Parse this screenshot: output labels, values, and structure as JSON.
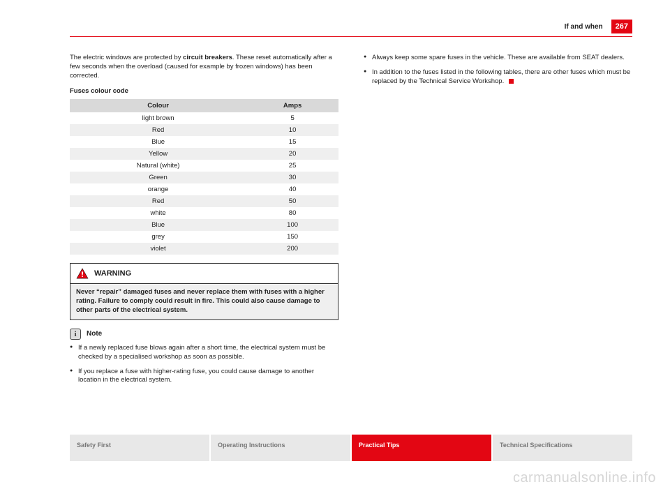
{
  "header": {
    "section": "If and when",
    "page": "267"
  },
  "col1": {
    "intro": "The electric windows are protected by circuit breakers. These reset automatically after a few seconds when the overload (caused for example by frozen windows) has been corrected.",
    "intro_bold": "circuit breakers",
    "table_title": "Fuses colour code",
    "table": {
      "headers": [
        "Colour",
        "Amps"
      ],
      "rows": [
        [
          "light brown",
          "5"
        ],
        [
          "Red",
          "10"
        ],
        [
          "Blue",
          "15"
        ],
        [
          "Yellow",
          "20"
        ],
        [
          "Natural (white)",
          "25"
        ],
        [
          "Green",
          "30"
        ],
        [
          "orange",
          "40"
        ],
        [
          "Red",
          "50"
        ],
        [
          "white",
          "80"
        ],
        [
          "Blue",
          "100"
        ],
        [
          "grey",
          "150"
        ],
        [
          "violet",
          "200"
        ]
      ]
    },
    "warning_title": "WARNING",
    "warning_body": "Never “repair” damaged fuses and never replace them with fuses with a higher rating. Failure to comply could result in fire. This could also cause damage to other parts of the electrical system.",
    "note_title": "Note",
    "note_bullets": [
      "If a newly replaced fuse blows again after a short time, the electrical system must be checked by a specialised workshop as soon as possible.",
      "If you replace a fuse with higher-rating fuse, you could cause damage to another location in the electrical system."
    ]
  },
  "col2": {
    "bullets": [
      "Always keep some spare fuses in the vehicle. These are available from SEAT dealers.",
      "In addition to the fuses listed in the following tables, there are other fuses which must be replaced by the Technical Service Workshop."
    ]
  },
  "tabs": [
    "Safety First",
    "Operating Instructions",
    "Practical Tips",
    "Technical Specifications"
  ],
  "watermark": "carmanualsonline.info",
  "chart_data": {
    "type": "table",
    "title": "Fuses colour code",
    "columns": [
      "Colour",
      "Amps"
    ],
    "rows": [
      {
        "Colour": "light brown",
        "Amps": 5
      },
      {
        "Colour": "Red",
        "Amps": 10
      },
      {
        "Colour": "Blue",
        "Amps": 15
      },
      {
        "Colour": "Yellow",
        "Amps": 20
      },
      {
        "Colour": "Natural (white)",
        "Amps": 25
      },
      {
        "Colour": "Green",
        "Amps": 30
      },
      {
        "Colour": "orange",
        "Amps": 40
      },
      {
        "Colour": "Red",
        "Amps": 50
      },
      {
        "Colour": "white",
        "Amps": 80
      },
      {
        "Colour": "Blue",
        "Amps": 100
      },
      {
        "Colour": "grey",
        "Amps": 150
      },
      {
        "Colour": "violet",
        "Amps": 200
      }
    ]
  }
}
